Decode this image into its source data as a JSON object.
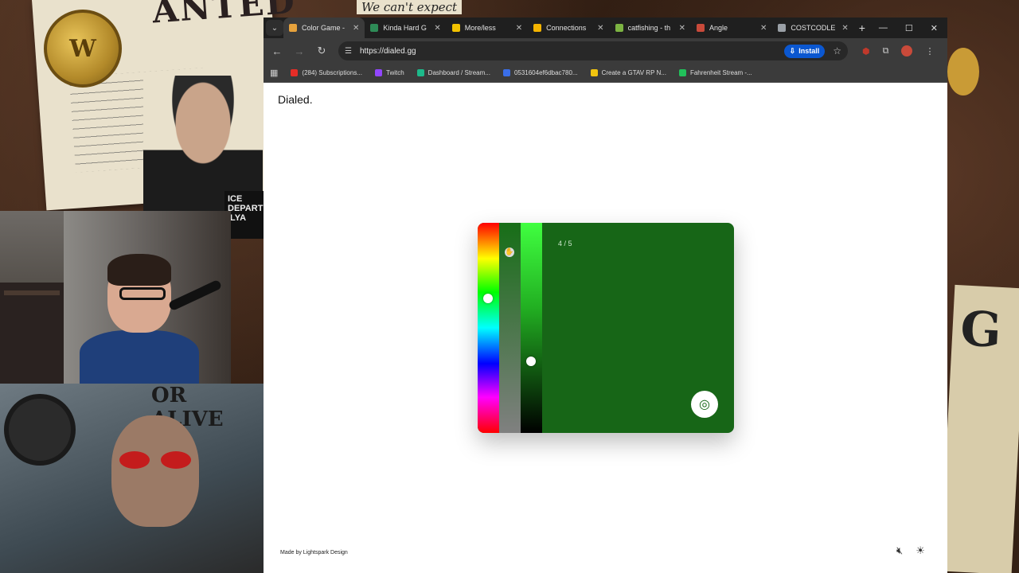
{
  "overlay": {
    "top_poster_word": "ANTED",
    "top_note": "We can't expect",
    "coin_letter": "W",
    "police_sign": "ICE DEPARTMENT ILYA",
    "bottom_poster_text": "OR ALIVE",
    "right_poster_text": "G"
  },
  "browser": {
    "tabs": [
      {
        "title": "Color Game -",
        "favicon_color": "#e6a23c",
        "active": true
      },
      {
        "title": "Kinda Hard G",
        "favicon_color": "#2e8b57",
        "active": false
      },
      {
        "title": "More/less",
        "favicon_color": "#f2c200",
        "active": false
      },
      {
        "title": "Connections",
        "favicon_color": "#f4b400",
        "active": false
      },
      {
        "title": "catfishing - th",
        "favicon_color": "#7cb342",
        "active": false
      },
      {
        "title": "Angle",
        "favicon_color": "#c94a3a",
        "active": false
      },
      {
        "title": "COSTCODLE",
        "favicon_color": "#9aa0a6",
        "active": false
      }
    ],
    "new_tab_glyph": "+",
    "window_controls": [
      "—",
      "☐",
      "✕"
    ],
    "url": "https://dialed.gg",
    "install_label": "Install",
    "bookmarks": [
      {
        "label": "(284) Subscriptions...",
        "color": "#e52d27"
      },
      {
        "label": "Twitch",
        "color": "#9146ff"
      },
      {
        "label": "Dashboard / Stream...",
        "color": "#1db98a"
      },
      {
        "label": "0531604ef6dbac780...",
        "color": "#3a6ee8"
      },
      {
        "label": "Create a GTAV RP N...",
        "color": "#f1c40f"
      },
      {
        "label": "Fahrenheit Stream -...",
        "color": "#21c05a"
      }
    ]
  },
  "page": {
    "brand": "Dialed.",
    "game": {
      "progress": "4 / 5",
      "target_color": "#176617",
      "hue_position": 0.36,
      "lightness_position": 0.66,
      "saturation_position": 0.14
    },
    "footer_credit": "Made by Lightspark Design"
  }
}
